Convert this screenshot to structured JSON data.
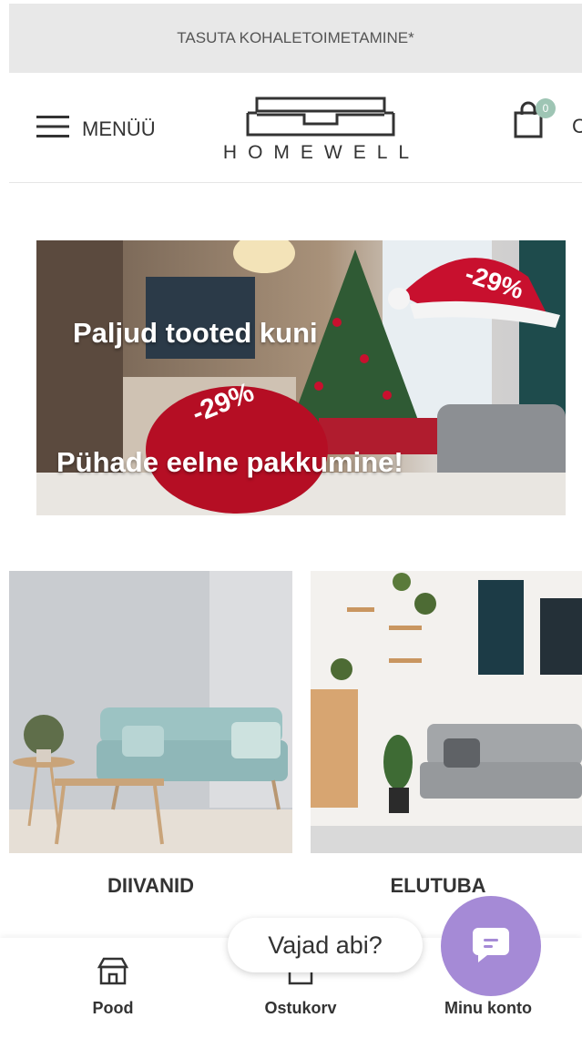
{
  "topbar": {
    "text": "TASUTA KOHALETOIMETAMINE*"
  },
  "header": {
    "menu_label": "MENÜÜ",
    "brand": "HOMEWELL",
    "cart_count": "0",
    "cart_label_partial": "C"
  },
  "banner": {
    "line1": "Paljud tooted kuni",
    "line2": "Pühade eelne pakkumine!",
    "discount_1": "-29%",
    "discount_2": "-29%"
  },
  "categories": [
    {
      "label": "DIIVANID",
      "icon": "sofa-image"
    },
    {
      "label": "ELUTUBA",
      "icon": "living-room-image"
    }
  ],
  "bottom_nav": {
    "items": [
      {
        "label": "Pood",
        "icon": "shop-icon"
      },
      {
        "label": "Ostukorv",
        "icon": "bag-icon"
      },
      {
        "label": "Minu konto",
        "icon": "user-icon"
      }
    ]
  },
  "chat": {
    "prompt": "Vajad abi?",
    "icon": "chat-icon"
  },
  "colors": {
    "accent_cart": "#9ec5b4",
    "chat_purple": "#a58ad6",
    "topbar_bg": "#e8e8e8",
    "banner_red": "#c8102e"
  }
}
